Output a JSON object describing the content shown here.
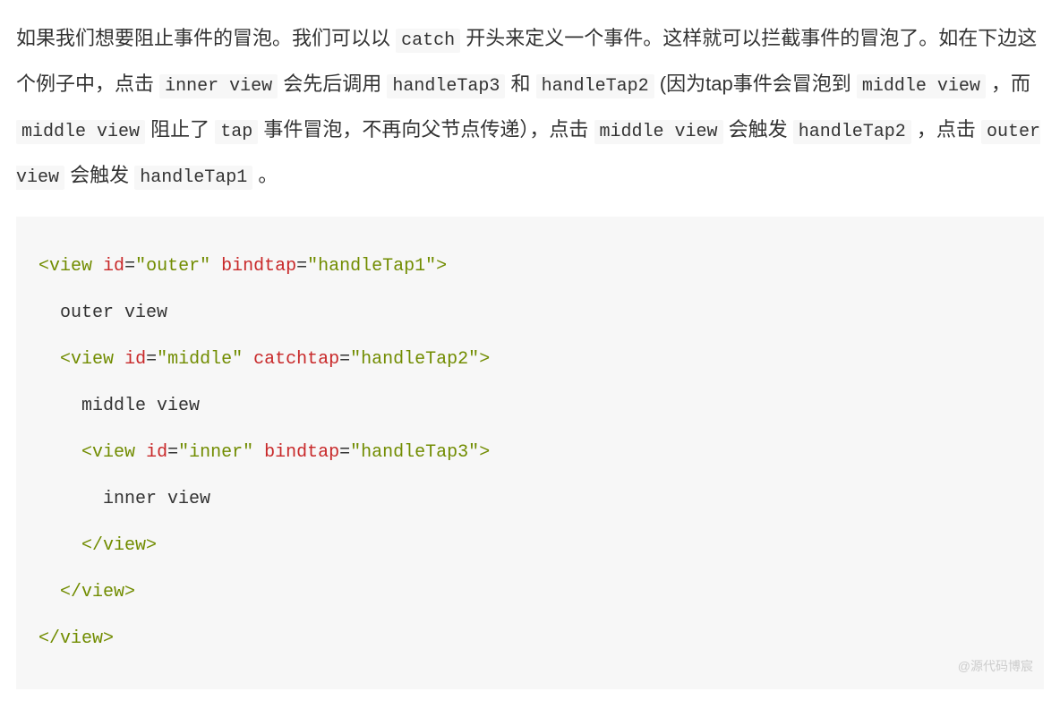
{
  "paragraph": {
    "t1": "如果我们想要阻止事件的冒泡。我们可以以 ",
    "c1": "catch",
    "t2": " 开头来定义一个事件。这样就可以拦截事件的冒泡了。如在下边这个例子中，点击 ",
    "c2": "inner view",
    "t3": " 会先后调用 ",
    "c3": "handleTap3",
    "t4": " 和 ",
    "c4": "handleTap2",
    "t5": " (因为tap事件会冒泡到 ",
    "c5": "middle view",
    "t6": " ，而 ",
    "c6": "middle view",
    "t7": " 阻止了 ",
    "c7": "tap",
    "t8": " 事件冒泡，不再向父节点传递），点击 ",
    "c8": "middle view",
    "t9": " 会触发 ",
    "c9": "handleTap2",
    "t10": " ，点击 ",
    "c10": "outer view",
    "t11": " 会触发 ",
    "c11": "handleTap1",
    "t12": " 。"
  },
  "code": {
    "l1_open": "<",
    "l1_tag": "view",
    "l1_sp1": " ",
    "l1_attr1": "id",
    "l1_eq1": "=",
    "l1_val1": "\"outer\"",
    "l1_sp2": " ",
    "l1_attr2": "bindtap",
    "l1_eq2": "=",
    "l1_val2": "\"handleTap1\"",
    "l1_close": ">",
    "l2_text": "  outer view",
    "l3_indent": "  ",
    "l3_open": "<",
    "l3_tag": "view",
    "l3_sp1": " ",
    "l3_attr1": "id",
    "l3_eq1": "=",
    "l3_val1": "\"middle\"",
    "l3_sp2": " ",
    "l3_attr2": "catchtap",
    "l3_eq2": "=",
    "l3_val2": "\"handleTap2\"",
    "l3_close": ">",
    "l4_text": "    middle view",
    "l5_indent": "    ",
    "l5_open": "<",
    "l5_tag": "view",
    "l5_sp1": " ",
    "l5_attr1": "id",
    "l5_eq1": "=",
    "l5_val1": "\"inner\"",
    "l5_sp2": " ",
    "l5_attr2": "bindtap",
    "l5_eq2": "=",
    "l5_val2": "\"handleTap3\"",
    "l5_close": ">",
    "l6_text": "      inner view",
    "l7_indent": "    ",
    "l7_open": "</",
    "l7_tag": "view",
    "l7_close": ">",
    "l8_indent": "  ",
    "l8_open": "</",
    "l8_tag": "view",
    "l8_close": ">",
    "l9_open": "</",
    "l9_tag": "view",
    "l9_close": ">"
  },
  "watermark": "@源代码博宸"
}
